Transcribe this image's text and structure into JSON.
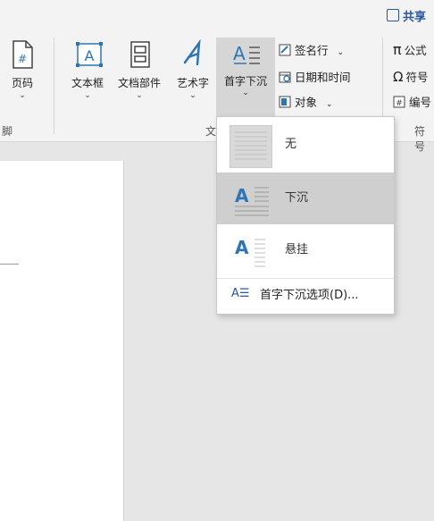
{
  "ribbon": {
    "share_label": "共享",
    "items": {
      "page_number": "页码",
      "text_box": "文本框",
      "quick_parts": "文档部件",
      "wordart": "艺术字",
      "drop_cap": "首字下沉",
      "signature_line": "签名行",
      "date_time": "日期和时间",
      "object": "对象",
      "equation": "公式",
      "symbol": "符号",
      "numbering": "编号"
    },
    "groups": {
      "header_footer": "脚",
      "text": "文",
      "symbols": "符号"
    },
    "chevron": "⌄",
    "accent_color": "#2b579a",
    "icon_blue": "#2e75b6"
  },
  "dropcap_menu": {
    "items": [
      {
        "label": "无",
        "icon": "dropcap-none-icon"
      },
      {
        "label": "下沉",
        "icon": "dropcap-dropped-icon"
      },
      {
        "label": "悬挂",
        "icon": "dropcap-margin-icon"
      }
    ],
    "options_label": "首字下沉选项(D)...",
    "selected_index": 1,
    "options_icon_glyph": "A☰",
    "thumb_letter": "A"
  }
}
